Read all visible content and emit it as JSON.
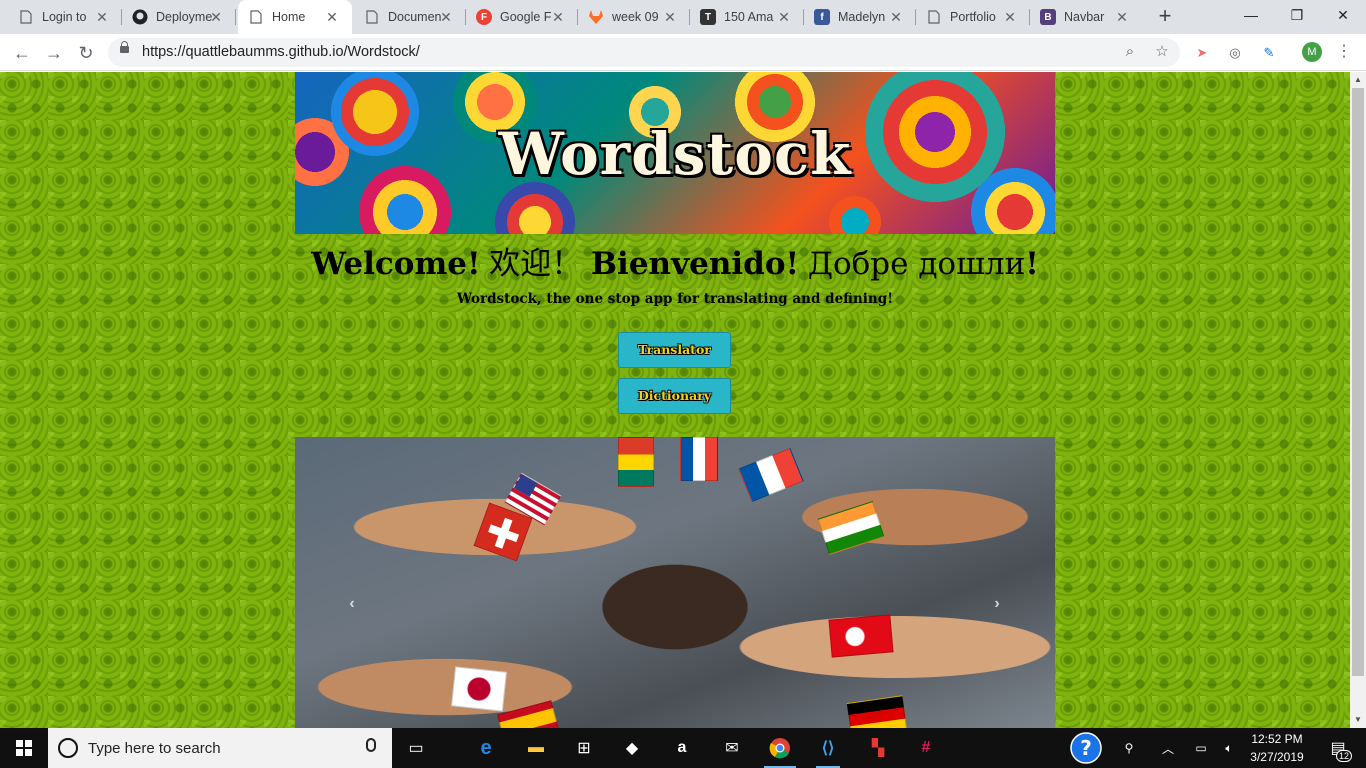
{
  "browser": {
    "tabs": [
      {
        "title": "Login to",
        "icon": "document-icon"
      },
      {
        "title": "Deployme",
        "icon": "github-icon"
      },
      {
        "title": "Home",
        "icon": "document-icon",
        "active": true
      },
      {
        "title": "Documen",
        "icon": "document-icon"
      },
      {
        "title": "Google F",
        "icon": "google-fonts-icon"
      },
      {
        "title": "week 09",
        "icon": "gitlab-icon"
      },
      {
        "title": "150 Ama",
        "icon": "t-icon"
      },
      {
        "title": "Madelyn",
        "icon": "facebook-icon"
      },
      {
        "title": "Portfolio",
        "icon": "document-icon"
      },
      {
        "title": "Navbar",
        "icon": "bootstrap-icon"
      }
    ],
    "url": "https://quattlebaumms.github.io/Wordstock/",
    "profile_initial": "M"
  },
  "page": {
    "banner_title": "Wordstock",
    "welcome": {
      "en": "Welcome!",
      "zh": "欢迎！",
      "es": "Bienvenido!",
      "ru": "Добре дошли",
      "ru_bang": "!"
    },
    "tagline": "Wordstock, the one stop app for translating and defining!",
    "buttons": {
      "translator": "Translator",
      "dictionary": "Dictionary"
    },
    "carousel": {
      "prev": "‹",
      "next": "›"
    }
  },
  "taskbar": {
    "search_placeholder": "Type here to search",
    "time": "12:52 PM",
    "date": "3/27/2019",
    "notification_count": "12"
  },
  "colors": {
    "page_background": "#7fb20d",
    "button_bg": "#29b6c8",
    "button_text": "#f5d21a"
  }
}
